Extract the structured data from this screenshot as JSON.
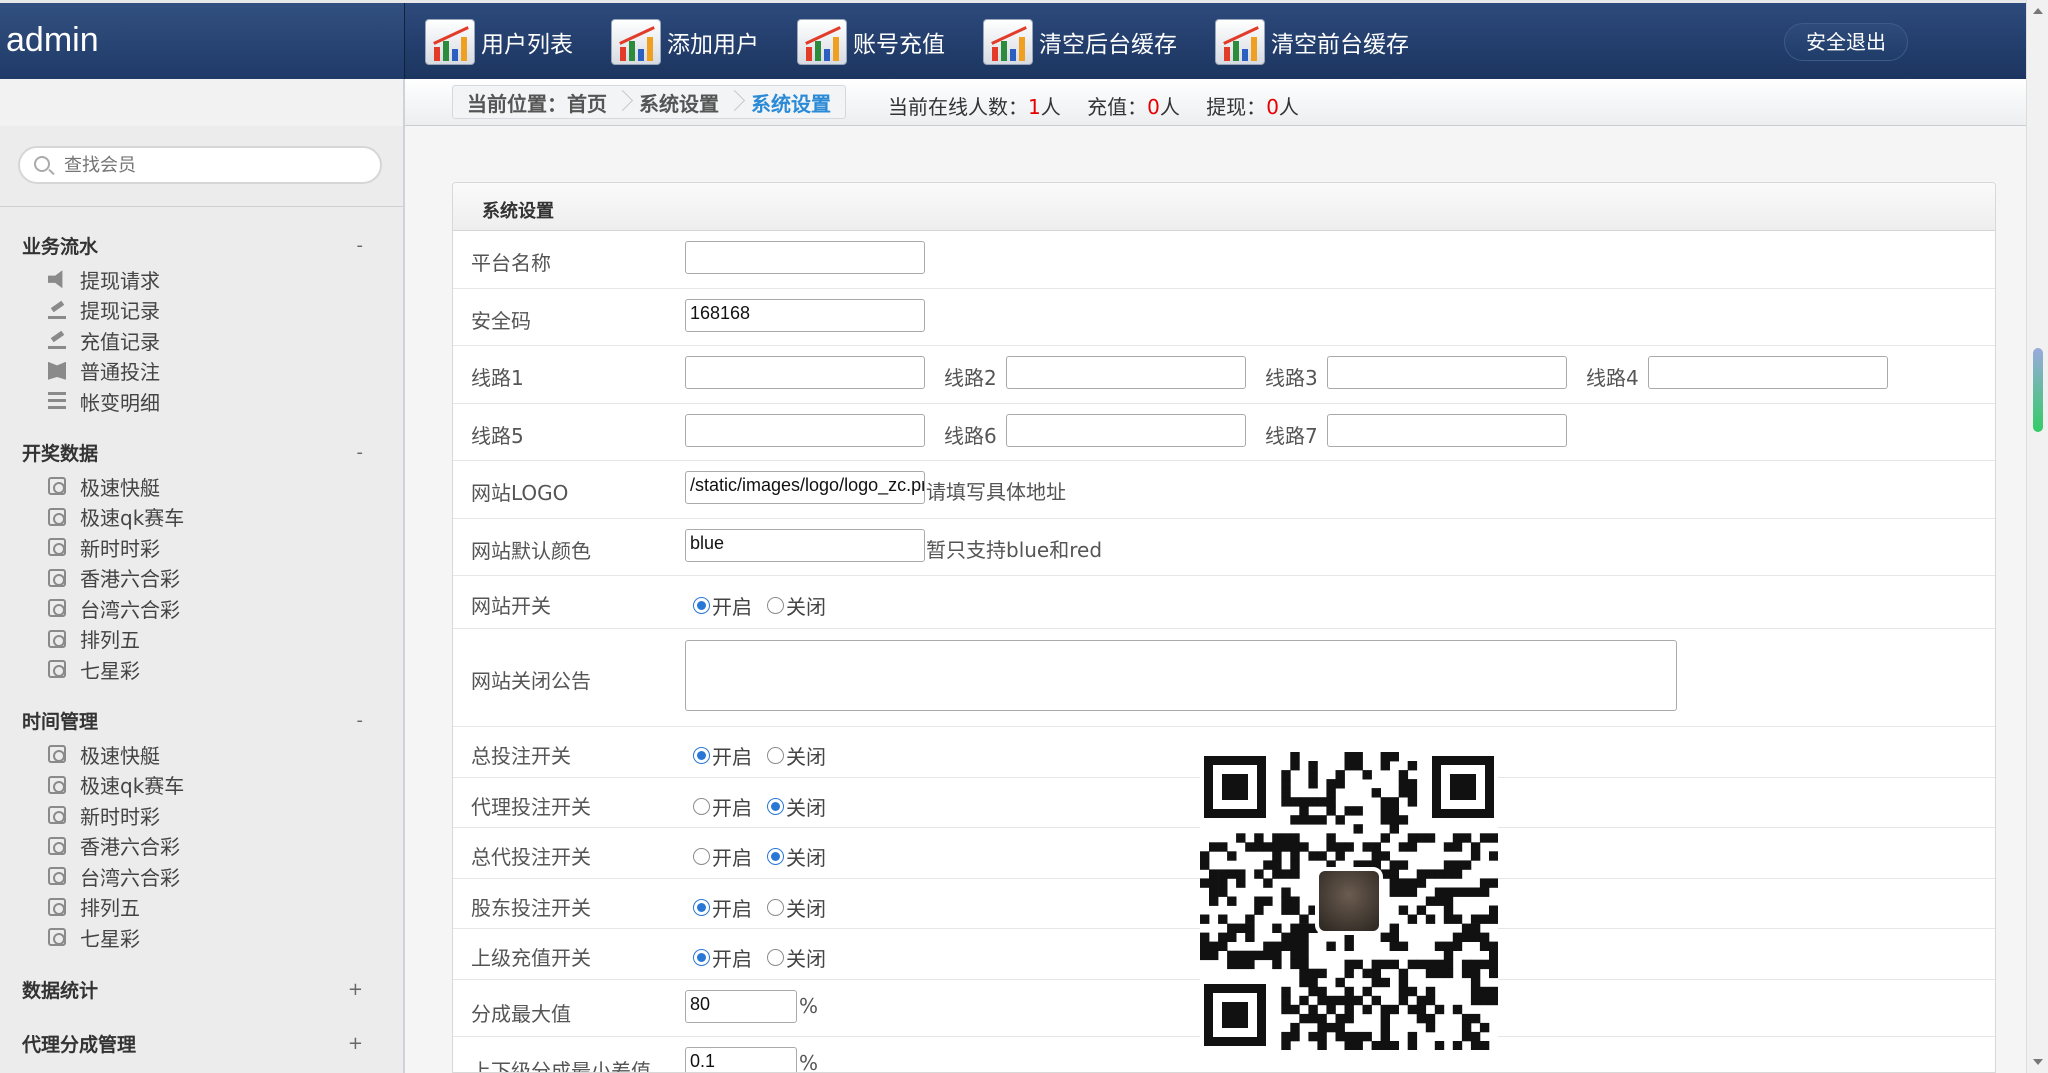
{
  "header": {
    "brand": "admin",
    "nav": [
      "用户列表",
      "添加用户",
      "账号充值",
      "清空后台缓存",
      "清空前台缓存"
    ],
    "logout": "安全退出"
  },
  "breadcrumb": {
    "items": [
      "当前位置：首页",
      "系统设置",
      "系统设置"
    ],
    "stats": {
      "online_label": "当前在线人数：",
      "online_value": "1",
      "online_unit": "人",
      "recharge_label": "充值：",
      "recharge_value": "0",
      "recharge_unit": "人",
      "withdraw_label": "提现：",
      "withdraw_value": "0",
      "withdraw_unit": "人"
    }
  },
  "sidebar": {
    "search_placeholder": "查找会员",
    "sections": [
      {
        "title": "业务流水",
        "toggle": "-",
        "items": [
          {
            "label": "提现请求",
            "icon": "speaker-icon"
          },
          {
            "label": "提现记录",
            "icon": "edit-icon"
          },
          {
            "label": "充值记录",
            "icon": "edit-icon"
          },
          {
            "label": "普通投注",
            "icon": "book-icon"
          },
          {
            "label": "帐变明细",
            "icon": "list-icon"
          }
        ]
      },
      {
        "title": "开奖数据",
        "toggle": "-",
        "items": [
          {
            "label": "极速快艇",
            "icon": "target-icon"
          },
          {
            "label": "极速qk赛车",
            "icon": "target-icon"
          },
          {
            "label": "新时时彩",
            "icon": "target-icon"
          },
          {
            "label": "香港六合彩",
            "icon": "target-icon"
          },
          {
            "label": "台湾六合彩",
            "icon": "target-icon"
          },
          {
            "label": "排列五",
            "icon": "target-icon"
          },
          {
            "label": "七星彩",
            "icon": "target-icon"
          }
        ]
      },
      {
        "title": "时间管理",
        "toggle": "-",
        "items": [
          {
            "label": "极速快艇",
            "icon": "target-icon"
          },
          {
            "label": "极速qk赛车",
            "icon": "target-icon"
          },
          {
            "label": "新时时彩",
            "icon": "target-icon"
          },
          {
            "label": "香港六合彩",
            "icon": "target-icon"
          },
          {
            "label": "台湾六合彩",
            "icon": "target-icon"
          },
          {
            "label": "排列五",
            "icon": "target-icon"
          },
          {
            "label": "七星彩",
            "icon": "target-icon"
          }
        ]
      },
      {
        "title": "数据统计",
        "toggle": "+",
        "items": []
      },
      {
        "title": "代理分成管理",
        "toggle": "+",
        "items": []
      }
    ]
  },
  "form": {
    "title": "系统设置",
    "platform_name": {
      "label": "平台名称",
      "value": ""
    },
    "security_code": {
      "label": "安全码",
      "value": "168168"
    },
    "lines": [
      {
        "label": "线路1",
        "value": ""
      },
      {
        "label": "线路2",
        "value": ""
      },
      {
        "label": "线路3",
        "value": ""
      },
      {
        "label": "线路4",
        "value": ""
      },
      {
        "label": "线路5",
        "value": ""
      },
      {
        "label": "线路6",
        "value": ""
      },
      {
        "label": "线路7",
        "value": ""
      }
    ],
    "logo": {
      "label": "网站LOGO",
      "value": "/static/images/logo/logo_zc.png",
      "hint": "请填写具体地址"
    },
    "color": {
      "label": "网站默认颜色",
      "value": "blue",
      "hint": "暂只支持blue和red"
    },
    "site_switch": {
      "label": "网站开关",
      "on": "开启",
      "off": "关闭",
      "selected": "on"
    },
    "close_notice": {
      "label": "网站关闭公告",
      "value": ""
    },
    "bet_switch": {
      "label": "总投注开关",
      "on": "开启",
      "off": "关闭",
      "selected": "on"
    },
    "agent_bet_switch": {
      "label": "代理投注开关",
      "on": "开启",
      "off": "关闭",
      "selected": "off"
    },
    "general_agent_bet_switch": {
      "label": "总代投注开关",
      "on": "开启",
      "off": "关闭",
      "selected": "off"
    },
    "shareholder_bet_switch": {
      "label": "股东投注开关",
      "on": "开启",
      "off": "关闭",
      "selected": "on"
    },
    "superior_recharge_switch": {
      "label": "上级充值开关",
      "on": "开启",
      "off": "关闭",
      "selected": "on"
    },
    "max_share": {
      "label": "分成最大值",
      "value": "80",
      "unit": "%"
    },
    "min_diff": {
      "label": "上下级分成最小差值",
      "value": "0.1",
      "unit": "%"
    }
  },
  "icons": {
    "nav": "chart-icon",
    "search": "search-icon"
  },
  "colors": {
    "header": "#1f3a68",
    "accent": "#2a8ad6",
    "stat_red": "#e60000"
  }
}
